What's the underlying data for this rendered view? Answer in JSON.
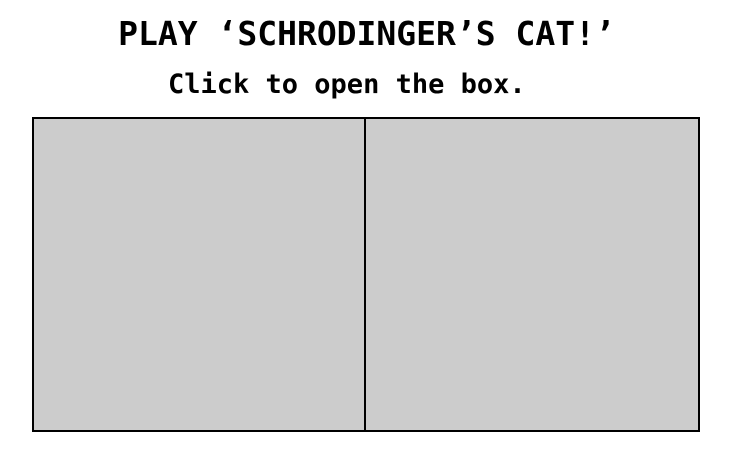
{
  "header": {
    "title": "PLAY ‘SCHRODINGER’S CAT!’",
    "instruction": "Click to open the box."
  },
  "board": {
    "background_color": "#cccccc",
    "border_color": "#000000",
    "boxes": [
      {
        "id": "left",
        "state": "closed"
      },
      {
        "id": "right",
        "state": "closed"
      }
    ]
  }
}
